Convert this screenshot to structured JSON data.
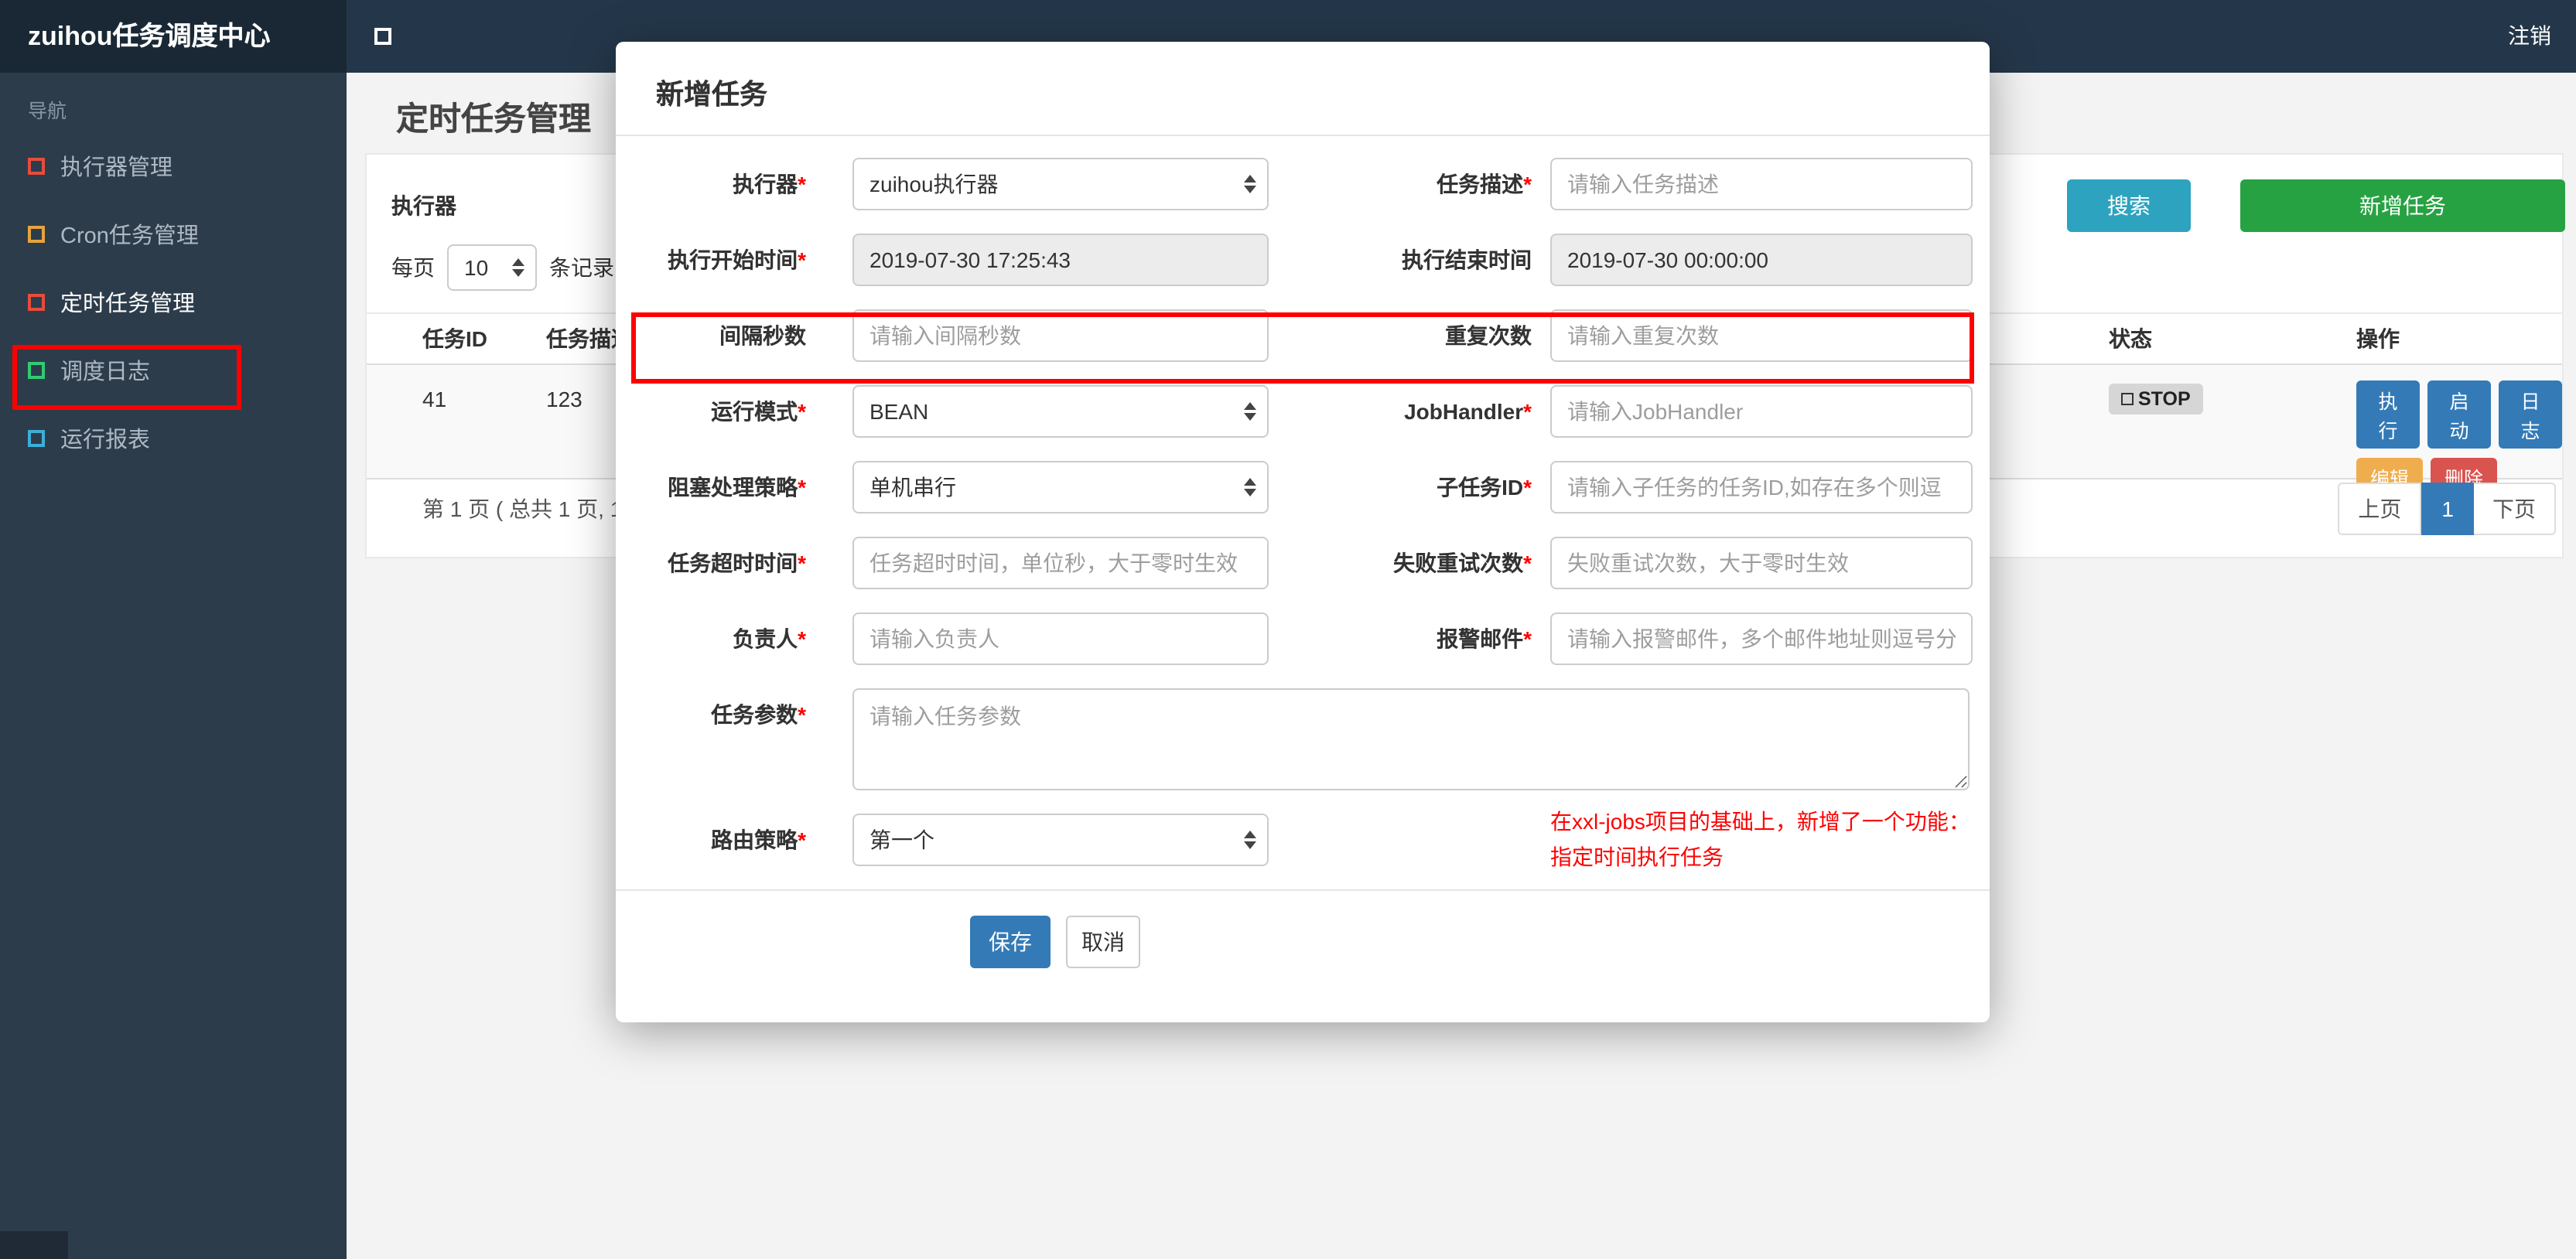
{
  "topbar": {
    "brand": "zuihou任务调度中心",
    "logout": "注销"
  },
  "sidebar": {
    "nav_label": "导航",
    "items": [
      {
        "label": "执行器管理",
        "icon_color": "#e74c3c"
      },
      {
        "label": "Cron任务管理",
        "icon_color": "#e8a33d"
      },
      {
        "label": "定时任务管理",
        "icon_color": "#e74c3c",
        "active": true
      },
      {
        "label": "调度日志",
        "icon_color": "#2ecc71"
      },
      {
        "label": "运行报表",
        "icon_color": "#3bafda"
      }
    ]
  },
  "page": {
    "title": "定时任务管理",
    "filter": {
      "executor_label": "执行器",
      "search_button": "搜索",
      "add_button": "新增任务"
    },
    "per_page": {
      "prefix": "每页",
      "value": "10",
      "suffix": "条记录"
    },
    "table": {
      "headers": [
        "任务ID",
        "任务描述",
        "状态",
        "操作"
      ],
      "row": {
        "id": "41",
        "desc": "123",
        "status": "STOP",
        "actions": [
          "执行",
          "启动",
          "日志",
          "编辑",
          "删除"
        ]
      }
    },
    "pagination": {
      "summary": "第 1 页 ( 总共 1 页, 1",
      "prev": "上页",
      "current": "1",
      "next": "下页"
    }
  },
  "modal": {
    "title": "新增任务",
    "required_mark": "*",
    "rows": [
      {
        "left": {
          "label": "执行器",
          "required": true,
          "type": "select",
          "value": "zuihou执行器"
        },
        "right": {
          "label": "任务描述",
          "required": true,
          "type": "input",
          "placeholder": "请输入任务描述"
        }
      },
      {
        "left": {
          "label": "执行开始时间",
          "required": true,
          "type": "readonly",
          "value": "2019-07-30 17:25:43"
        },
        "right": {
          "label": "执行结束时间",
          "required": false,
          "type": "readonly",
          "value": "2019-07-30 00:00:00"
        }
      },
      {
        "left": {
          "label": "间隔秒数",
          "required": false,
          "type": "input",
          "placeholder": "请输入间隔秒数"
        },
        "right": {
          "label": "重复次数",
          "required": false,
          "type": "input",
          "placeholder": "请输入重复次数"
        }
      },
      {
        "left": {
          "label": "运行模式",
          "required": true,
          "type": "select",
          "value": "BEAN"
        },
        "right": {
          "label": "JobHandler",
          "required": true,
          "type": "input",
          "placeholder": "请输入JobHandler"
        }
      },
      {
        "left": {
          "label": "阻塞处理策略",
          "required": true,
          "type": "select",
          "value": "单机串行"
        },
        "right": {
          "label": "子任务ID",
          "required": true,
          "type": "input",
          "placeholder": "请输入子任务的任务ID,如存在多个则逗"
        }
      },
      {
        "left": {
          "label": "任务超时时间",
          "required": true,
          "type": "input",
          "placeholder": "任务超时时间，单位秒，大于零时生效"
        },
        "right": {
          "label": "失败重试次数",
          "required": true,
          "type": "input",
          "placeholder": "失败重试次数，大于零时生效"
        }
      },
      {
        "left": {
          "label": "负责人",
          "required": true,
          "type": "input",
          "placeholder": "请输入负责人"
        },
        "right": {
          "label": "报警邮件",
          "required": true,
          "type": "input",
          "placeholder": "请输入报警邮件，多个邮件地址则逗号分"
        }
      }
    ],
    "param_field": {
      "label": "任务参数",
      "placeholder": "请输入任务参数"
    },
    "route_field": {
      "label": "路由策略",
      "value": "第一个"
    },
    "note": {
      "line1": "在xxl-jobs项目的基础上，新增了一个功能：",
      "line2": "指定时间执行任务"
    },
    "save_button": "保存",
    "cancel_button": "取消"
  },
  "colors": {
    "topbar": "#24374a",
    "brand_bg": "#192834",
    "sidebar": "#2d3c4b",
    "search_button": "#2ea3bf",
    "add_button": "#27a243",
    "action_blue": "#337ab7",
    "action_orange": "#f0ad4e",
    "action_red": "#d9534f",
    "annotation": "#ff0000"
  }
}
